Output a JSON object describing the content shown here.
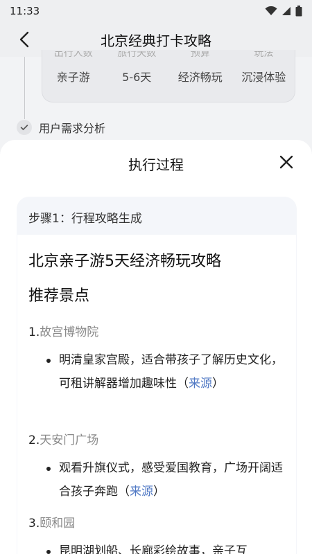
{
  "status_bar": {
    "time": "11:33"
  },
  "header": {
    "title": "北京经典打卡攻略"
  },
  "params": {
    "labels": [
      "出行人数",
      "旅行天数",
      "预算",
      "玩法"
    ],
    "values": [
      "亲子游",
      "5-6天",
      "经济畅玩",
      "沉浸体验"
    ]
  },
  "analysis": {
    "label": "用户需求分析"
  },
  "sheet": {
    "title": "执行过程",
    "step_label": "步骤1：行程攻略生成",
    "article_title": "北京亲子游5天经济畅玩攻略",
    "section_title": "推荐景点",
    "items": [
      {
        "num": "1.",
        "name": "故宫博物院",
        "desc": "明清皇家宫殿，适合带孩子了解历史文化，可租讲解器增加趣味性（",
        "source": "来源",
        "close": "）"
      },
      {
        "num": "2.",
        "name": "天安门广场",
        "desc": "观看升旗仪式，感受爱国教育，广场开阔适合孩子奔跑（",
        "source": "来源",
        "close": "）"
      },
      {
        "num": "3.",
        "name": "颐和园",
        "desc": "昆明湖划船、长廊彩绘故事，亲子互"
      }
    ]
  }
}
